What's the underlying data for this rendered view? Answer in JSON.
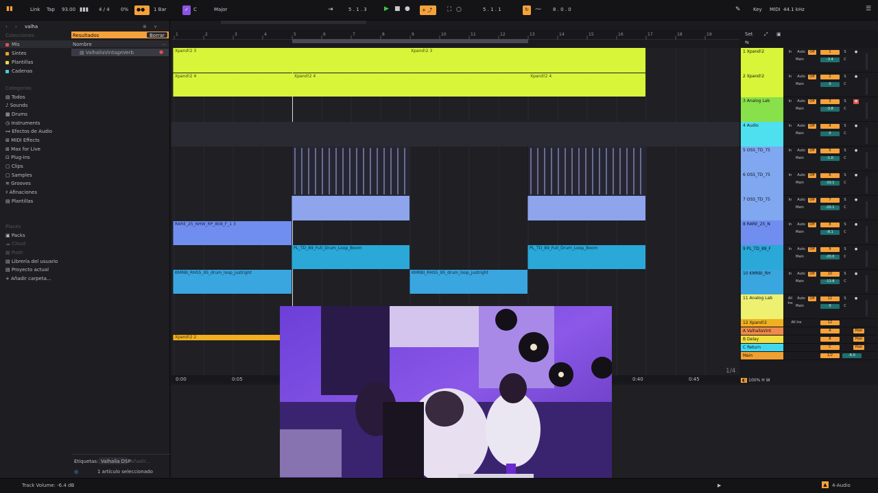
{
  "topbar": {
    "link": "Link",
    "tap": "Tap",
    "tempo": "93.00",
    "signature": "4 / 4",
    "cpu_pct": "0%",
    "quantize": "1 Bar",
    "key": "C",
    "scale": "Major",
    "position": "5 . 1 . 3",
    "loop_start": "5 . 1 . 1",
    "loop_length": "8 . 0 . 0",
    "key_label": "Key",
    "midi_label": "MIDI",
    "sample_rate": "44.1 kHz"
  },
  "browser": {
    "search_value": "valha",
    "collections_title": "Colecciones",
    "collections": [
      {
        "label": "Mis",
        "color": "#e0524a"
      },
      {
        "label": "Sintes",
        "color": "#f0a030"
      },
      {
        "label": "Plantillas",
        "color": "#e8d84a"
      },
      {
        "label": "Cadenas",
        "color": "#4fc9e8"
      }
    ],
    "categories_title": "Categorías",
    "categories": [
      "Todos",
      "Sounds",
      "Drums",
      "Instruments",
      "Efectos de Audio",
      "MIDI Effects",
      "Max for Live",
      "Plug-ins",
      "Clips",
      "Samples",
      "Grooves",
      "Afinaciones",
      "Plantillas"
    ],
    "places_title": "Places",
    "places": [
      "Packs",
      "Cloud",
      "Push",
      "Librería del usuario",
      "Proyecto actual",
      "Añadir carpeta..."
    ],
    "results_label": "Resultados",
    "clear_label": "Borrar",
    "column_name": "Nombre",
    "result_item": "ValhallaVintageVerb",
    "tags_label": "Etiquetas:",
    "tag_value": "Valhalla DSP",
    "tag_add": "Añadir...",
    "selection_status": "1 artículo seleccionado"
  },
  "ruler": [
    "1",
    "2",
    "3",
    "4",
    "5",
    "6",
    "7",
    "8",
    "9",
    "10",
    "11",
    "12",
    "13",
    "14",
    "15",
    "16",
    "17",
    "18",
    "19"
  ],
  "time_ruler": [
    "0:00",
    "0:05",
    "0:40",
    "0:45"
  ],
  "tracks": [
    {
      "clip_a": "Xpand!2 3",
      "clip_b": "Xpand!2 3",
      "color": "#d8f53a"
    },
    {
      "clip_a": "Xpand!2 4",
      "clip_b": "Xpand!2 4",
      "clip_c": "Xpand!2 4",
      "color": "#d8f53a"
    },
    {
      "clip_a": "RARE_25_NHW_RP_808_F_1 3",
      "color": "#6f8ef0"
    },
    {
      "clip_a": "PL_TD_89_Full_Drum_Loop_Boom",
      "clip_b": "PL_TD_89_Full_Drum_Loop_Boom",
      "color": "#2aa8d8"
    },
    {
      "clip_a": "KMRBI_RHS5_95_drum_loop_justright",
      "clip_b": "KMRBI_RHS5_95_drum_loop_justright",
      "color": "#3aa6e0"
    },
    {
      "clip_a": "Xpand!2 2",
      "color": "#f0b020"
    }
  ],
  "mixer": {
    "set_label": "Set",
    "channels": [
      {
        "name": "1 Xpand!2",
        "color": "#d8f53a",
        "num": "1",
        "vol": "-3.4",
        "route_in": "In",
        "auto": "Auto",
        "off": "Off",
        "out": "Main"
      },
      {
        "name": "2 Xpand!2",
        "color": "#d8f53a",
        "num": "2",
        "vol": "0",
        "route_in": "In",
        "auto": "Auto",
        "off": "Off",
        "out": "Main"
      },
      {
        "name": "3 Analog Lab",
        "color": "#88e04a",
        "num": "3",
        "vol": "-3.8",
        "route_in": "In",
        "auto": "Auto",
        "off": "Off",
        "out": "Main"
      },
      {
        "name": "4 Audio",
        "color": "#4fe0f0",
        "num": "4",
        "vol": "0",
        "route_in": "In",
        "auto": "Auto",
        "off": "Off",
        "out": "Main"
      },
      {
        "name": "5 OSS_TD_75",
        "color": "#7fa8f0",
        "num": "5",
        "vol": "-1.0",
        "route_in": "In",
        "auto": "Auto",
        "off": "Off",
        "out": "Main"
      },
      {
        "name": "6 OSS_TD_75",
        "color": "#7fa8f0",
        "num": "6",
        "vol": "-10.1",
        "route_in": "In",
        "auto": "Auto",
        "off": "Off",
        "out": "Main"
      },
      {
        "name": "7 OSS_TD_75",
        "color": "#7fa8f0",
        "num": "7",
        "vol": "-20.1",
        "route_in": "In",
        "auto": "Auto",
        "off": "Off",
        "out": "Main"
      },
      {
        "name": "8 RARE_25_N",
        "color": "#6f8ef0",
        "num": "8",
        "vol": "-8.1",
        "route_in": "In",
        "auto": "Auto",
        "off": "Off",
        "out": "Main"
      },
      {
        "name": "9 PL_TD_89_F",
        "color": "#2aa8d8",
        "num": "9",
        "vol": "-20.0",
        "route_in": "In",
        "auto": "Auto",
        "off": "Off",
        "out": "Main"
      },
      {
        "name": "10 KMRBI_RH",
        "color": "#3aa6e0",
        "num": "10",
        "vol": "-13.8",
        "route_in": "In",
        "auto": "Auto",
        "off": "Off",
        "out": "Main"
      },
      {
        "name": "11 Analog Lab",
        "color": "#eef070",
        "num": "11",
        "vol": "0",
        "route_in": "All Ins",
        "auto": "Auto",
        "off": "Off",
        "out": "Main"
      }
    ],
    "returns": [
      {
        "name": "12 Xpand!2",
        "color": "#f0b020",
        "num": "12",
        "route_in": "All Ins"
      },
      {
        "name": "A ValhallaVint",
        "color": "#f08a4a",
        "num": "A",
        "post": "Post"
      },
      {
        "name": "B Delay",
        "color": "#f0e040",
        "num": "B",
        "post": "Post"
      },
      {
        "name": "C Return",
        "color": "#40d8f0",
        "num": "C",
        "post": "Post"
      },
      {
        "name": "Main",
        "color": "#f0a030",
        "num": "1/2",
        "vol": "-6.0"
      }
    ],
    "zoom": "1/4",
    "percent": "100%",
    "h": "H",
    "w": "W"
  },
  "status": {
    "left": "Track Volume: -6.4 dB",
    "right": "4-Audio"
  }
}
